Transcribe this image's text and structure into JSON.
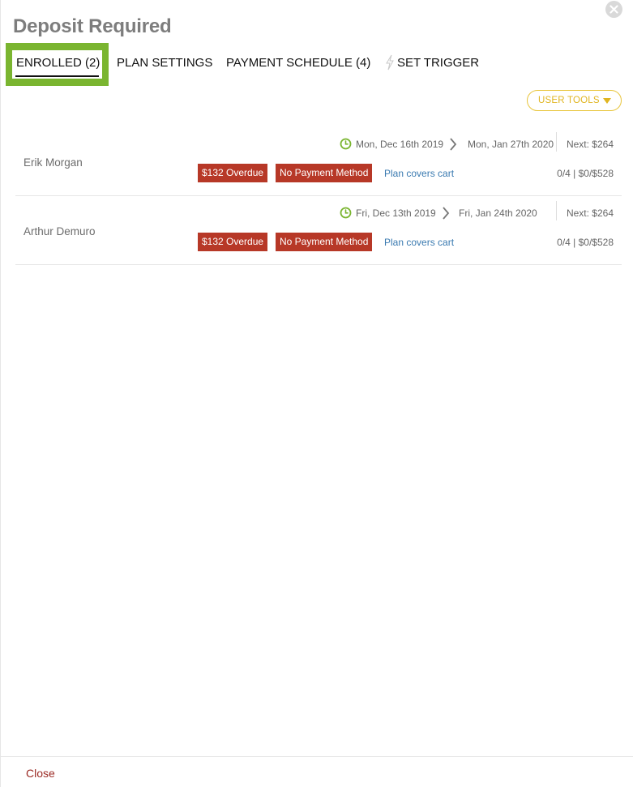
{
  "modal": {
    "title": "Deposit Required",
    "close_label": "Close"
  },
  "tabs": [
    {
      "label": "ENROLLED (2)",
      "active": true
    },
    {
      "label": "PLAN SETTINGS",
      "active": false
    },
    {
      "label": "PAYMENT SCHEDULE (4)",
      "active": false
    },
    {
      "label": "SET TRIGGER",
      "active": false,
      "icon": "bolt-icon"
    }
  ],
  "user_tools": {
    "label": "USER TOOLS",
    "icon": "caret-down-icon"
  },
  "enrollees": [
    {
      "name": "Erik Morgan",
      "start_date": "Mon, Dec 16th 2019",
      "end_date": "Mon, Jan 27th 2020",
      "next": "Next: $264",
      "overdue_badge": "$132 Overdue",
      "payment_badge": "No Payment Method",
      "plan_link": "Plan covers cart",
      "progress": "0/4 | $0/$528"
    },
    {
      "name": "Arthur Demuro",
      "start_date": "Fri, Dec 13th 2019",
      "end_date": "Fri, Jan 24th 2020",
      "next": "Next: $264",
      "overdue_badge": "$132 Overdue",
      "payment_badge": "No Payment Method",
      "plan_link": "Plan covers cart",
      "progress": "0/4 | $0/$528"
    }
  ],
  "colors": {
    "active_tab_highlight": "#7ab530",
    "badge_red": "#b73827",
    "user_tools_gold": "#e0b520",
    "link_blue": "#3a7ab0",
    "close_link": "#9b2a24",
    "clock_green": "#7ab530"
  }
}
